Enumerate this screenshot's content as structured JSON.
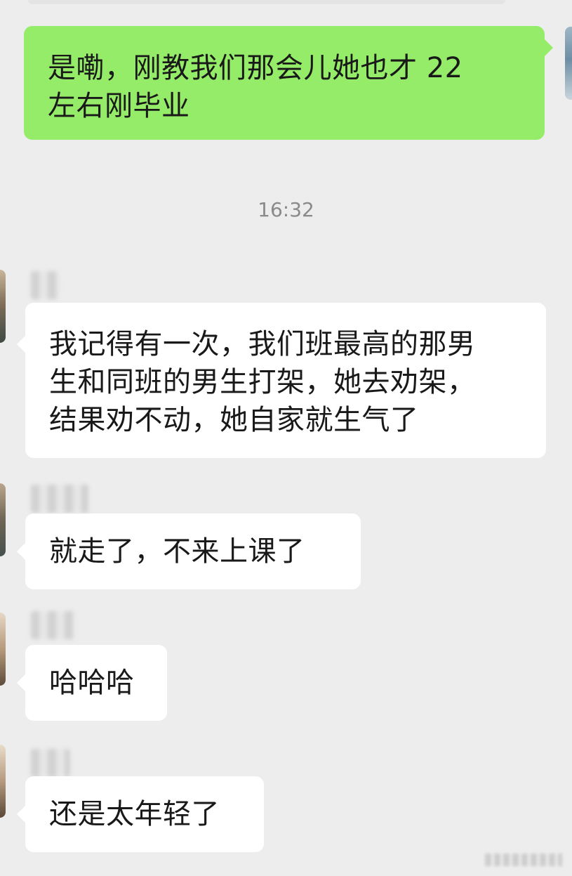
{
  "chat": {
    "timestamp": "16:32",
    "messages": [
      {
        "sender": "self",
        "text": "是嘞，刚教我们那会儿她也才 22\n左右刚毕业"
      },
      {
        "sender": "other",
        "text": "我记得有一次，我们班最高的那男\n生和同班的男生打架，她去劝架，\n结果劝不动，她自家就生气了"
      },
      {
        "sender": "other",
        "text": "就走了，不来上课了"
      },
      {
        "sender": "other",
        "text": "哈哈哈"
      },
      {
        "sender": "other",
        "text": "还是太年轻了"
      }
    ]
  },
  "colors": {
    "background": "#ededed",
    "self_bubble": "#95ec69",
    "other_bubble": "#ffffff",
    "text": "#191919",
    "timestamp": "#8a8a8a"
  }
}
